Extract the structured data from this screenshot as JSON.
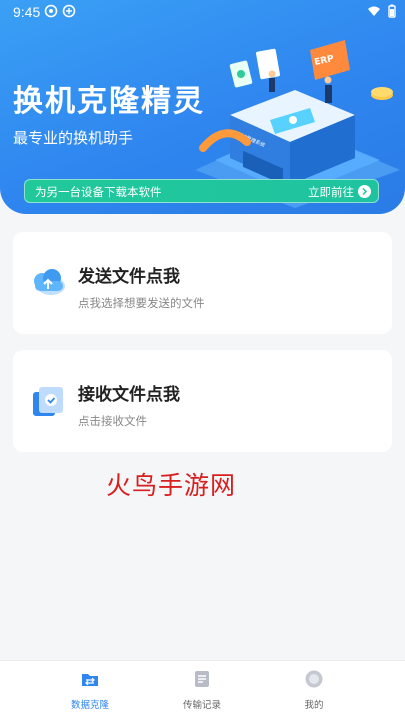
{
  "status_bar": {
    "time": "9:45"
  },
  "header": {
    "title": "换机克隆精灵",
    "subtitle": "最专业的换机助手",
    "illustration_labels": {
      "erp_sign": "ERP",
      "screen_text": "ERP管理系统"
    }
  },
  "banner": {
    "text": "为另一台设备下载本软件",
    "action": "立即前往"
  },
  "cards": [
    {
      "title": "发送文件点我",
      "description": "点我选择想要发送的文件",
      "icon": "cloud-upload-icon"
    },
    {
      "title": "接收文件点我",
      "description": "点击接收文件",
      "icon": "file-check-icon"
    }
  ],
  "watermark": "火鸟手游网",
  "bottom_nav": {
    "items": [
      {
        "label": "数据克隆",
        "icon": "folder-transfer-icon",
        "active": true
      },
      {
        "label": "传输记录",
        "icon": "document-list-icon",
        "active": false
      },
      {
        "label": "我的",
        "icon": "profile-icon",
        "active": false
      }
    ]
  },
  "colors": {
    "primary": "#2f86ef",
    "banner": "#21c89a",
    "watermark": "#d81f1f"
  }
}
